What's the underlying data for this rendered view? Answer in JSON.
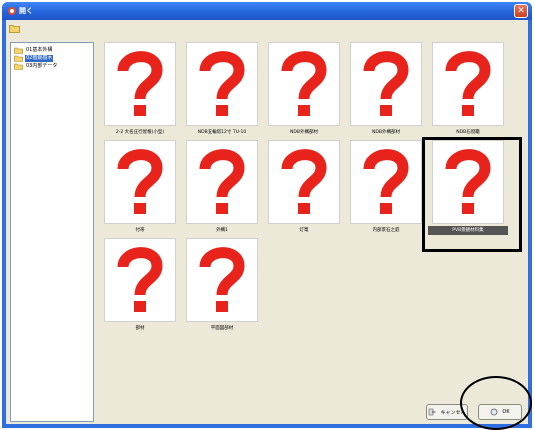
{
  "window": {
    "title": "開く",
    "close_label": "✕"
  },
  "tree": {
    "items": [
      {
        "label": "01基本外構",
        "selected": false
      },
      {
        "label": "02植栽樹木",
        "selected": true
      },
      {
        "label": "03内部データ",
        "selected": false
      }
    ]
  },
  "thumbnails": [
    {
      "caption": "2-2 大名庄行屋根(小型)",
      "selected": false
    },
    {
      "caption": "NDB五輪塔12寸 TU-10",
      "selected": false
    },
    {
      "caption": "NDB外構部材",
      "selected": false
    },
    {
      "caption": "NDB外構部材",
      "selected": false
    },
    {
      "caption": "NDB石燈籠",
      "selected": false
    },
    {
      "caption": "付帯",
      "selected": false
    },
    {
      "caption": "外構1",
      "selected": false
    },
    {
      "caption": "灯篭",
      "selected": false
    },
    {
      "caption": "内部景石之庭",
      "selected": false
    },
    {
      "caption": "PVB景観材料集",
      "selected": true
    },
    {
      "caption": "部材",
      "selected": false
    },
    {
      "caption": "平面図部材",
      "selected": false
    }
  ],
  "buttons": {
    "cancel_label": "キャンセル",
    "ok_label": "OK"
  },
  "colors": {
    "placeholder_mark": "#e8231b",
    "title_bar": "#2462d8",
    "selected": "#316ac5"
  }
}
